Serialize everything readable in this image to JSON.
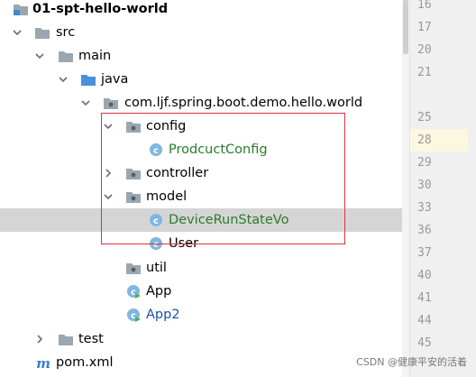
{
  "tree": {
    "items": [
      {
        "label": "01-spt-hello-world",
        "icon": "module-folder-icon",
        "arrow": "expanded"
      },
      {
        "label": "src",
        "icon": "folder-icon",
        "arrow": "expanded"
      },
      {
        "label": "main",
        "icon": "folder-icon",
        "arrow": "expanded"
      },
      {
        "label": "java",
        "icon": "source-folder-icon",
        "arrow": "expanded"
      },
      {
        "label": "com.ljf.spring.boot.demo.hello.world",
        "icon": "package-icon",
        "arrow": "expanded"
      },
      {
        "label": "config",
        "icon": "package-icon",
        "arrow": "expanded"
      },
      {
        "label": "ProdcuctConfig",
        "icon": "class-icon"
      },
      {
        "label": "controller",
        "icon": "package-icon",
        "arrow": "collapsed"
      },
      {
        "label": "model",
        "icon": "package-icon",
        "arrow": "expanded"
      },
      {
        "label": "DeviceRunStateVo",
        "icon": "class-icon",
        "selected": true
      },
      {
        "label": "User",
        "icon": "class-icon"
      },
      {
        "label": "util",
        "icon": "package-icon"
      },
      {
        "label": "App",
        "icon": "spring-boot-class-icon"
      },
      {
        "label": "App2",
        "icon": "spring-boot-class-icon"
      },
      {
        "label": "test",
        "icon": "folder-icon",
        "arrow": "collapsed"
      },
      {
        "label": "pom.xml",
        "icon": "maven-icon"
      }
    ]
  },
  "gutter": {
    "line_numbers": [
      "16",
      "17",
      "20",
      "21",
      "25",
      "28",
      "29",
      "30",
      "33",
      "36",
      "37",
      "40",
      "41",
      "44",
      "45"
    ],
    "current_line": "28"
  },
  "colors": {
    "highlight_box": "#d9333f",
    "selected_row": "#d5d5d5",
    "class_label_green": "#2a7a2a",
    "class_label_blue": "#1f4fa8",
    "current_line_bg": "#fcf8df"
  },
  "watermark": "CSDN @健康平安的活着"
}
